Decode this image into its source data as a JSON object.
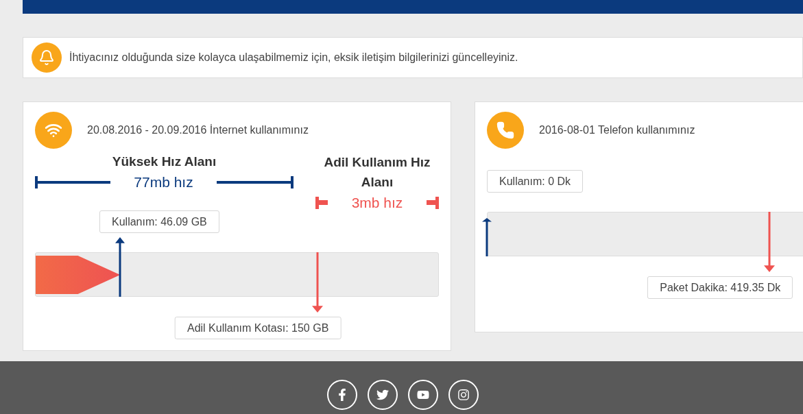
{
  "notice": {
    "text": "İhtiyacınız olduğunda size kolayca ulaşabilmemiz için, eksik iletişim bilgilerinizi güncelleyiniz."
  },
  "internet_card": {
    "title": "20.08.2016 - 20.09.2016 İnternet kullanımınız",
    "high_speed": {
      "title": "Yüksek Hız Alanı",
      "speed": "77mb hız"
    },
    "fair_speed": {
      "title": "Adil Kullanım Hız Alanı",
      "speed": "3mb hız"
    },
    "usage_label": "Kullanım: 46.09 GB",
    "usage": {
      "level": 0.21
    },
    "quota_label": "Adil Kullanım Kotası: 150 GB",
    "quota_marker": {
      "level": 0.7
    }
  },
  "phone_card": {
    "title": "2016-08-01 Telefon kullanımınız",
    "usage_label": "Kullanım: 0 Dk",
    "usage": {
      "level": 0
    },
    "quota_label": "Paket Dakika: 419.35 Dk",
    "quota_marker": {
      "level": 0.7
    }
  },
  "footer": {
    "social_links": [
      {
        "kind": "facebook"
      },
      {
        "kind": "twitter"
      },
      {
        "kind": "youtube"
      },
      {
        "kind": "instagram"
      }
    ]
  }
}
